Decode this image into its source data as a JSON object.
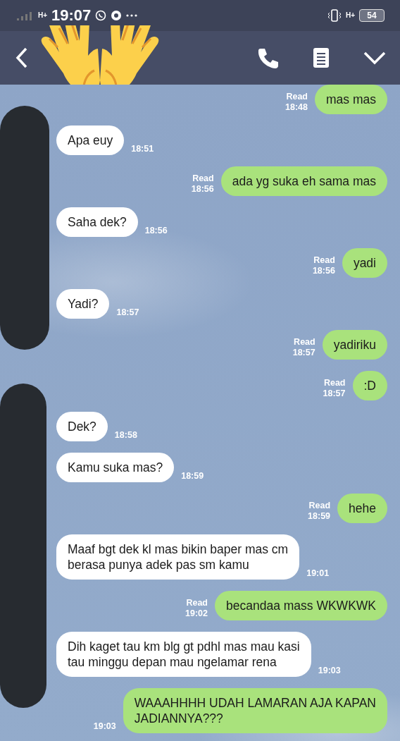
{
  "status_bar": {
    "network_left": "H+",
    "time": "19:07",
    "network_right": "H+",
    "battery": "54"
  },
  "messages": [
    {
      "kind": "sent",
      "text": "mas mas",
      "read_label": "Read",
      "time": "18:48"
    },
    {
      "kind": "received",
      "text": "Apa euy",
      "time": "18:51"
    },
    {
      "kind": "sent",
      "text": "ada yg suka eh sama mas",
      "read_label": "Read",
      "time": "18:56"
    },
    {
      "kind": "received",
      "text": "Saha dek?",
      "time": "18:56"
    },
    {
      "kind": "sent",
      "text": "yadi",
      "read_label": "Read",
      "time": "18:56"
    },
    {
      "kind": "received",
      "text": "Yadi?",
      "time": "18:57"
    },
    {
      "kind": "sent",
      "text": "yadiriku",
      "read_label": "Read",
      "time": "18:57"
    },
    {
      "kind": "sent",
      "text": ":D",
      "read_label": "Read",
      "time": "18:57"
    },
    {
      "kind": "received",
      "text": "Dek?",
      "time": "18:58"
    },
    {
      "kind": "received",
      "text": "Kamu suka mas?",
      "time": "18:59"
    },
    {
      "kind": "sent",
      "text": "hehe",
      "read_label": "Read",
      "time": "18:59"
    },
    {
      "kind": "received",
      "text": "Maaf bgt dek kl mas bikin baper mas cm\nberasa punya adek pas sm kamu",
      "time": "19:01"
    },
    {
      "kind": "sent",
      "text": "becandaa mass WKWKWK",
      "read_label": "Read",
      "time": "19:02"
    },
    {
      "kind": "received",
      "text": "Dih kaget tau km blg gt pdhl mas mau kasi\ntau minggu depan mau ngelamar rena",
      "time": "19:03"
    },
    {
      "kind": "sent",
      "text": "WAAAHHHH UDAH LAMARAN AJA KAPAN\nJADIANNYA???",
      "time": "19:03"
    }
  ]
}
